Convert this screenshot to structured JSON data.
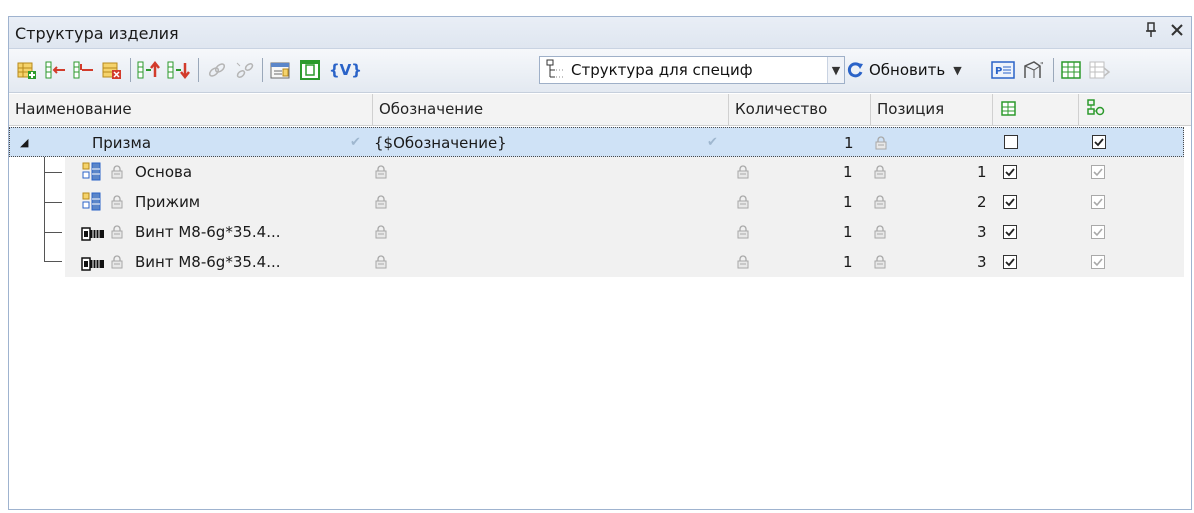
{
  "panel": {
    "title": "Структура изделия",
    "pin_glyph": "↕",
    "close_glyph": "✕"
  },
  "toolbar": {
    "icons": [
      "add-component-icon",
      "insert-before-icon",
      "insert-after-icon",
      "delete-component-icon",
      "move-up-icon",
      "move-down-icon",
      "link-icon",
      "unlink-icon",
      "properties-icon",
      "frame-icon",
      "variables-icon"
    ],
    "variables_label": "{V}",
    "combo_value": "Структура для специф",
    "refresh_label": "Обновить",
    "colors": {
      "accent_blue": "#2a63c8",
      "accent_green": "#2c9a2c",
      "accent_red": "#d23b2b",
      "accent_orange": "#e4892a"
    }
  },
  "columns": [
    {
      "key": "name",
      "label": "Наименование"
    },
    {
      "key": "designation",
      "label": "Обозначение"
    },
    {
      "key": "quantity",
      "label": "Количество"
    },
    {
      "key": "position",
      "label": "Позиция"
    },
    {
      "key": "in_spec_icon",
      "label": ""
    },
    {
      "key": "in_assembly_icon",
      "label": ""
    }
  ],
  "rows": [
    {
      "name": "Призма",
      "designation": "{$Обозначение}",
      "quantity": "1",
      "position": "",
      "col5_checked": false,
      "col6_checked": true,
      "selected": true,
      "type": "assembly"
    },
    {
      "name": "Основа",
      "designation": "",
      "quantity": "1",
      "position": "1",
      "col5_checked": true,
      "col6_checked": true,
      "type": "part"
    },
    {
      "name": "Прижим",
      "designation": "",
      "quantity": "1",
      "position": "2",
      "col5_checked": true,
      "col6_checked": true,
      "type": "part"
    },
    {
      "name": "Винт М8-6g*35.4...",
      "designation": "",
      "quantity": "1",
      "position": "3",
      "col5_checked": true,
      "col6_checked": true,
      "type": "standard"
    },
    {
      "name": "Винт М8-6g*35.4...",
      "designation": "",
      "quantity": "1",
      "position": "3",
      "col5_checked": true,
      "col6_checked": true,
      "type": "standard"
    }
  ]
}
